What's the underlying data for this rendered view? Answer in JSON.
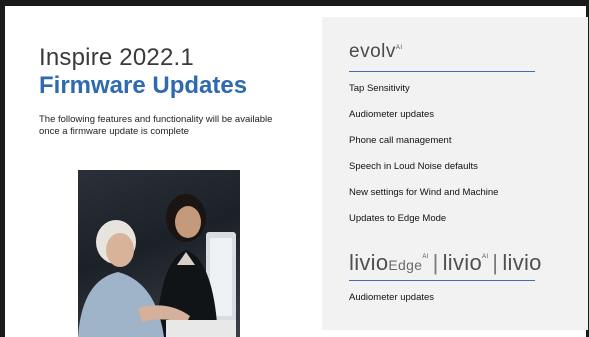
{
  "slide": {
    "title_line1": "Inspire 2022.1",
    "title_line2": "Firmware Updates",
    "intro": "The following features and functionality will be available once a firmware update is complete"
  },
  "panel": {
    "evolv_logo": {
      "name": "evolv",
      "suffix": "AI"
    },
    "evolv_features": [
      "Tap Sensitivity",
      "Audiometer updates",
      "Phone call management",
      "Speech in Loud Noise defaults",
      "New settings for Wind and Machine",
      "Updates to Edge Mode"
    ],
    "livio_logo": {
      "name1": "livio",
      "edge": "Edge",
      "suffix1": "AI",
      "sep": "|",
      "name2": "livio",
      "suffix2": "AI",
      "name3": "livio"
    },
    "livio_features": [
      "Audiometer updates"
    ]
  },
  "colors": {
    "title_accent": "#2e6ab0",
    "rule": "#3f6fb0",
    "panel_bg": "#f2f2f2"
  }
}
